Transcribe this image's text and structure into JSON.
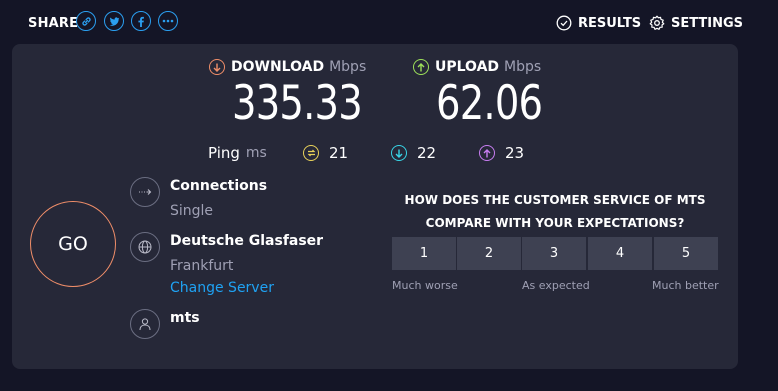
{
  "header": {
    "share_label": "SHARE",
    "share_icons": [
      "link-icon",
      "twitter-icon",
      "facebook-icon",
      "more-icon"
    ],
    "results_label": "RESULTS",
    "settings_label": "SETTINGS"
  },
  "metrics": {
    "download": {
      "label": "DOWNLOAD",
      "unit": "Mbps",
      "value": "335.33",
      "color": "#f08e69"
    },
    "upload": {
      "label": "UPLOAD",
      "unit": "Mbps",
      "value": "62.06",
      "color": "#9de05a"
    }
  },
  "ping": {
    "label": "Ping",
    "unit": "ms",
    "idle": {
      "value": "21",
      "color": "#e8d15a"
    },
    "download": {
      "value": "22",
      "color": "#38d4e6"
    },
    "upload": {
      "value": "23",
      "color": "#c77df0"
    }
  },
  "go_label": "GO",
  "connections": {
    "title": "Connections",
    "value": "Single"
  },
  "server": {
    "name": "Deutsche Glasfaser",
    "location": "Frankfurt",
    "change_label": "Change Server"
  },
  "provider": {
    "name": "mts"
  },
  "survey": {
    "question": "HOW DOES THE CUSTOMER SERVICE OF MTS COMPARE WITH YOUR EXPECTATIONS?",
    "ratings": [
      "1",
      "2",
      "3",
      "4",
      "5"
    ],
    "low_label": "Much worse",
    "mid_label": "As expected",
    "high_label": "Much better"
  }
}
